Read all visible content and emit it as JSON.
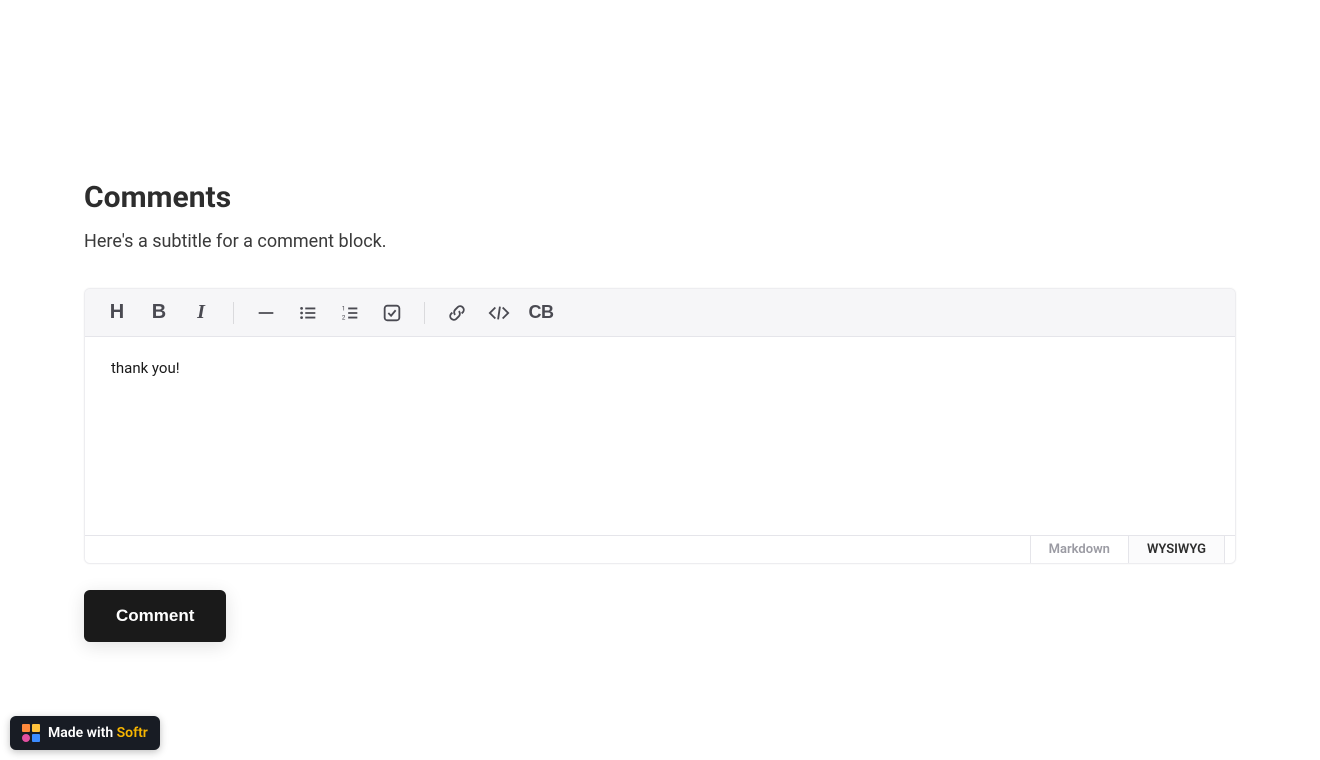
{
  "header": {
    "title": "Comments",
    "subtitle": "Here's a subtitle for a comment block."
  },
  "toolbar": {
    "h_label": "H",
    "b_label": "B",
    "i_label": "I",
    "cb_label": "CB"
  },
  "editor": {
    "content": "thank you!"
  },
  "modes": {
    "markdown": "Markdown",
    "wysiwyg": "WYSIWYG"
  },
  "submit": {
    "label": "Comment"
  },
  "badge": {
    "prefix": "Made with ",
    "brand": "Softr"
  }
}
